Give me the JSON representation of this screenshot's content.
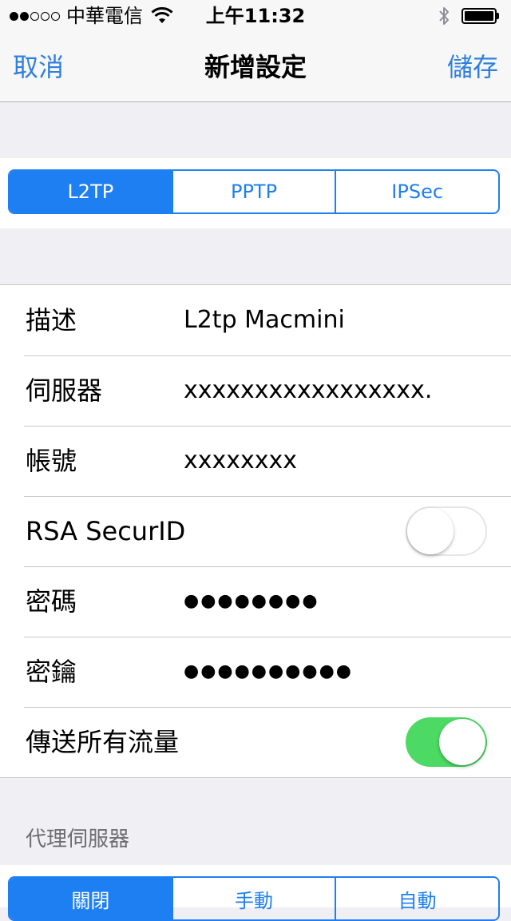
{
  "status_bar": {
    "signal_bars_filled": 2,
    "signal_bars_total": 5,
    "carrier": "中華電信",
    "time": "上午11:32",
    "wifi_icon": "wifi-icon",
    "bluetooth_icon": "bluetooth-icon",
    "battery_level": 1.0
  },
  "nav": {
    "cancel_label": "取消",
    "title": "新增設定",
    "save_label": "儲存",
    "accent_color": "#2f7fe0"
  },
  "vpn_type": {
    "options": [
      "L2TP",
      "PPTP",
      "IPSec"
    ],
    "selected": "L2TP"
  },
  "form": {
    "description": {
      "label": "描述",
      "value": "L2tp Macmini"
    },
    "server": {
      "label": "伺服器",
      "value": "xxxxxxxxxxxxxxxxx."
    },
    "account": {
      "label": "帳號",
      "value": "xxxxxxxx"
    },
    "rsa_securid": {
      "label": "RSA SecurID",
      "enabled": false
    },
    "password": {
      "label": "密碼",
      "value": "●●●●●●●●"
    },
    "secret": {
      "label": "密鑰",
      "value": "●●●●●●●●●●"
    },
    "send_all_traffic": {
      "label": "傳送所有流量",
      "enabled": true,
      "on_color": "#4cd964"
    }
  },
  "proxy": {
    "header": "代理伺服器",
    "options": [
      "關閉",
      "手動",
      "自動"
    ],
    "selected": "關閉"
  }
}
